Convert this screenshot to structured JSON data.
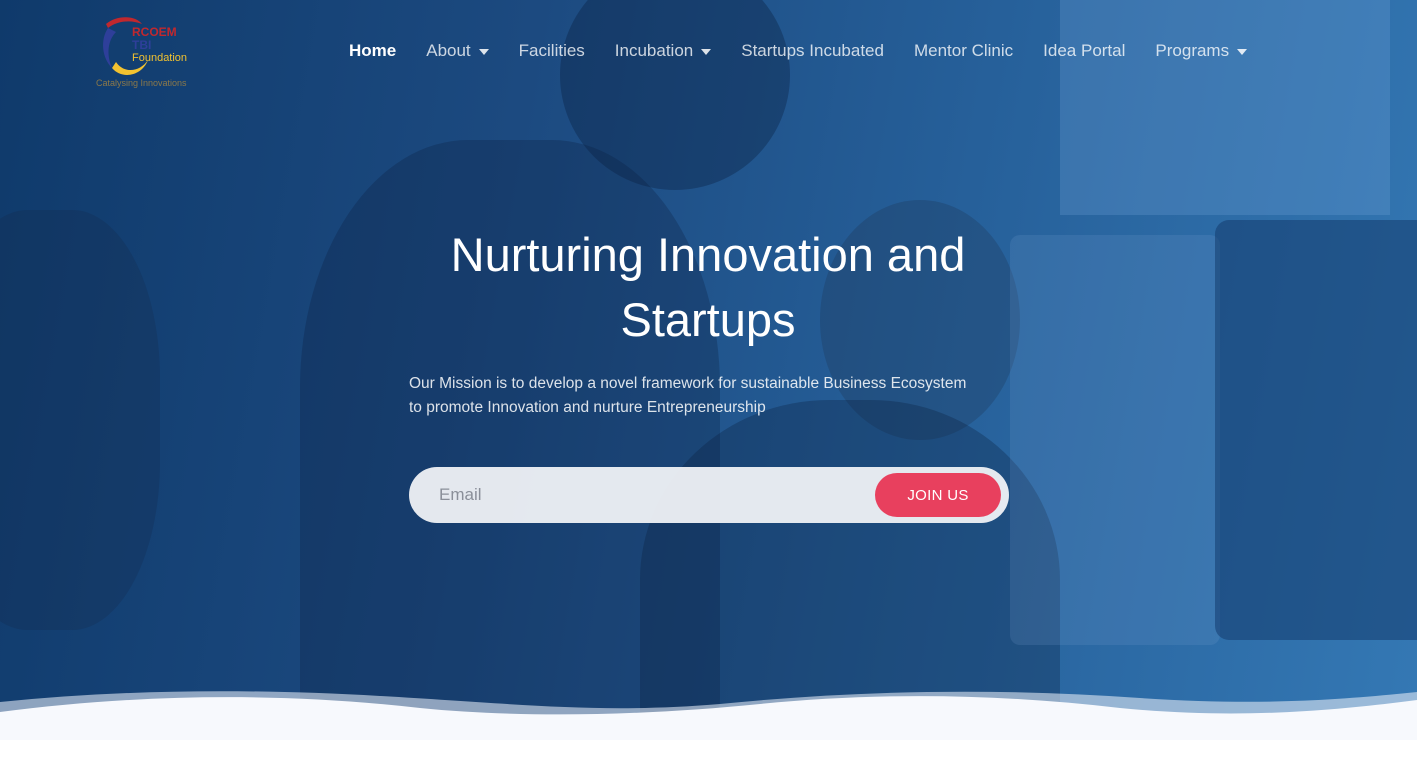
{
  "brand": {
    "logo_line1": "RCOEM",
    "logo_line2": "TBI",
    "logo_line3": "Foundation",
    "logo_tagline": "Catalysing Innovations"
  },
  "nav": {
    "items": [
      {
        "label": "Home",
        "active": true,
        "dropdown": false
      },
      {
        "label": "About",
        "active": false,
        "dropdown": true
      },
      {
        "label": "Facilities",
        "active": false,
        "dropdown": false
      },
      {
        "label": "Incubation",
        "active": false,
        "dropdown": true
      },
      {
        "label": "Startups Incubated",
        "active": false,
        "dropdown": false
      },
      {
        "label": "Mentor Clinic",
        "active": false,
        "dropdown": false
      },
      {
        "label": "Idea Portal",
        "active": false,
        "dropdown": false
      },
      {
        "label": "Programs",
        "active": false,
        "dropdown": true
      }
    ]
  },
  "hero": {
    "headline_line1": "Nurturing Innovation and",
    "headline_line2": "Startups",
    "mission_line1": "Our Mission is to develop a novel framework for sustainable Business Ecosystem",
    "mission_line2": "to promote Innovation and nurture Entrepreneurship"
  },
  "signup": {
    "email_placeholder": "Email",
    "email_value": "",
    "join_label": "JOIN US"
  },
  "colors": {
    "accent": "#e8405e",
    "hero_dark": "#0f3a6b",
    "hero_light": "#3478b4"
  }
}
